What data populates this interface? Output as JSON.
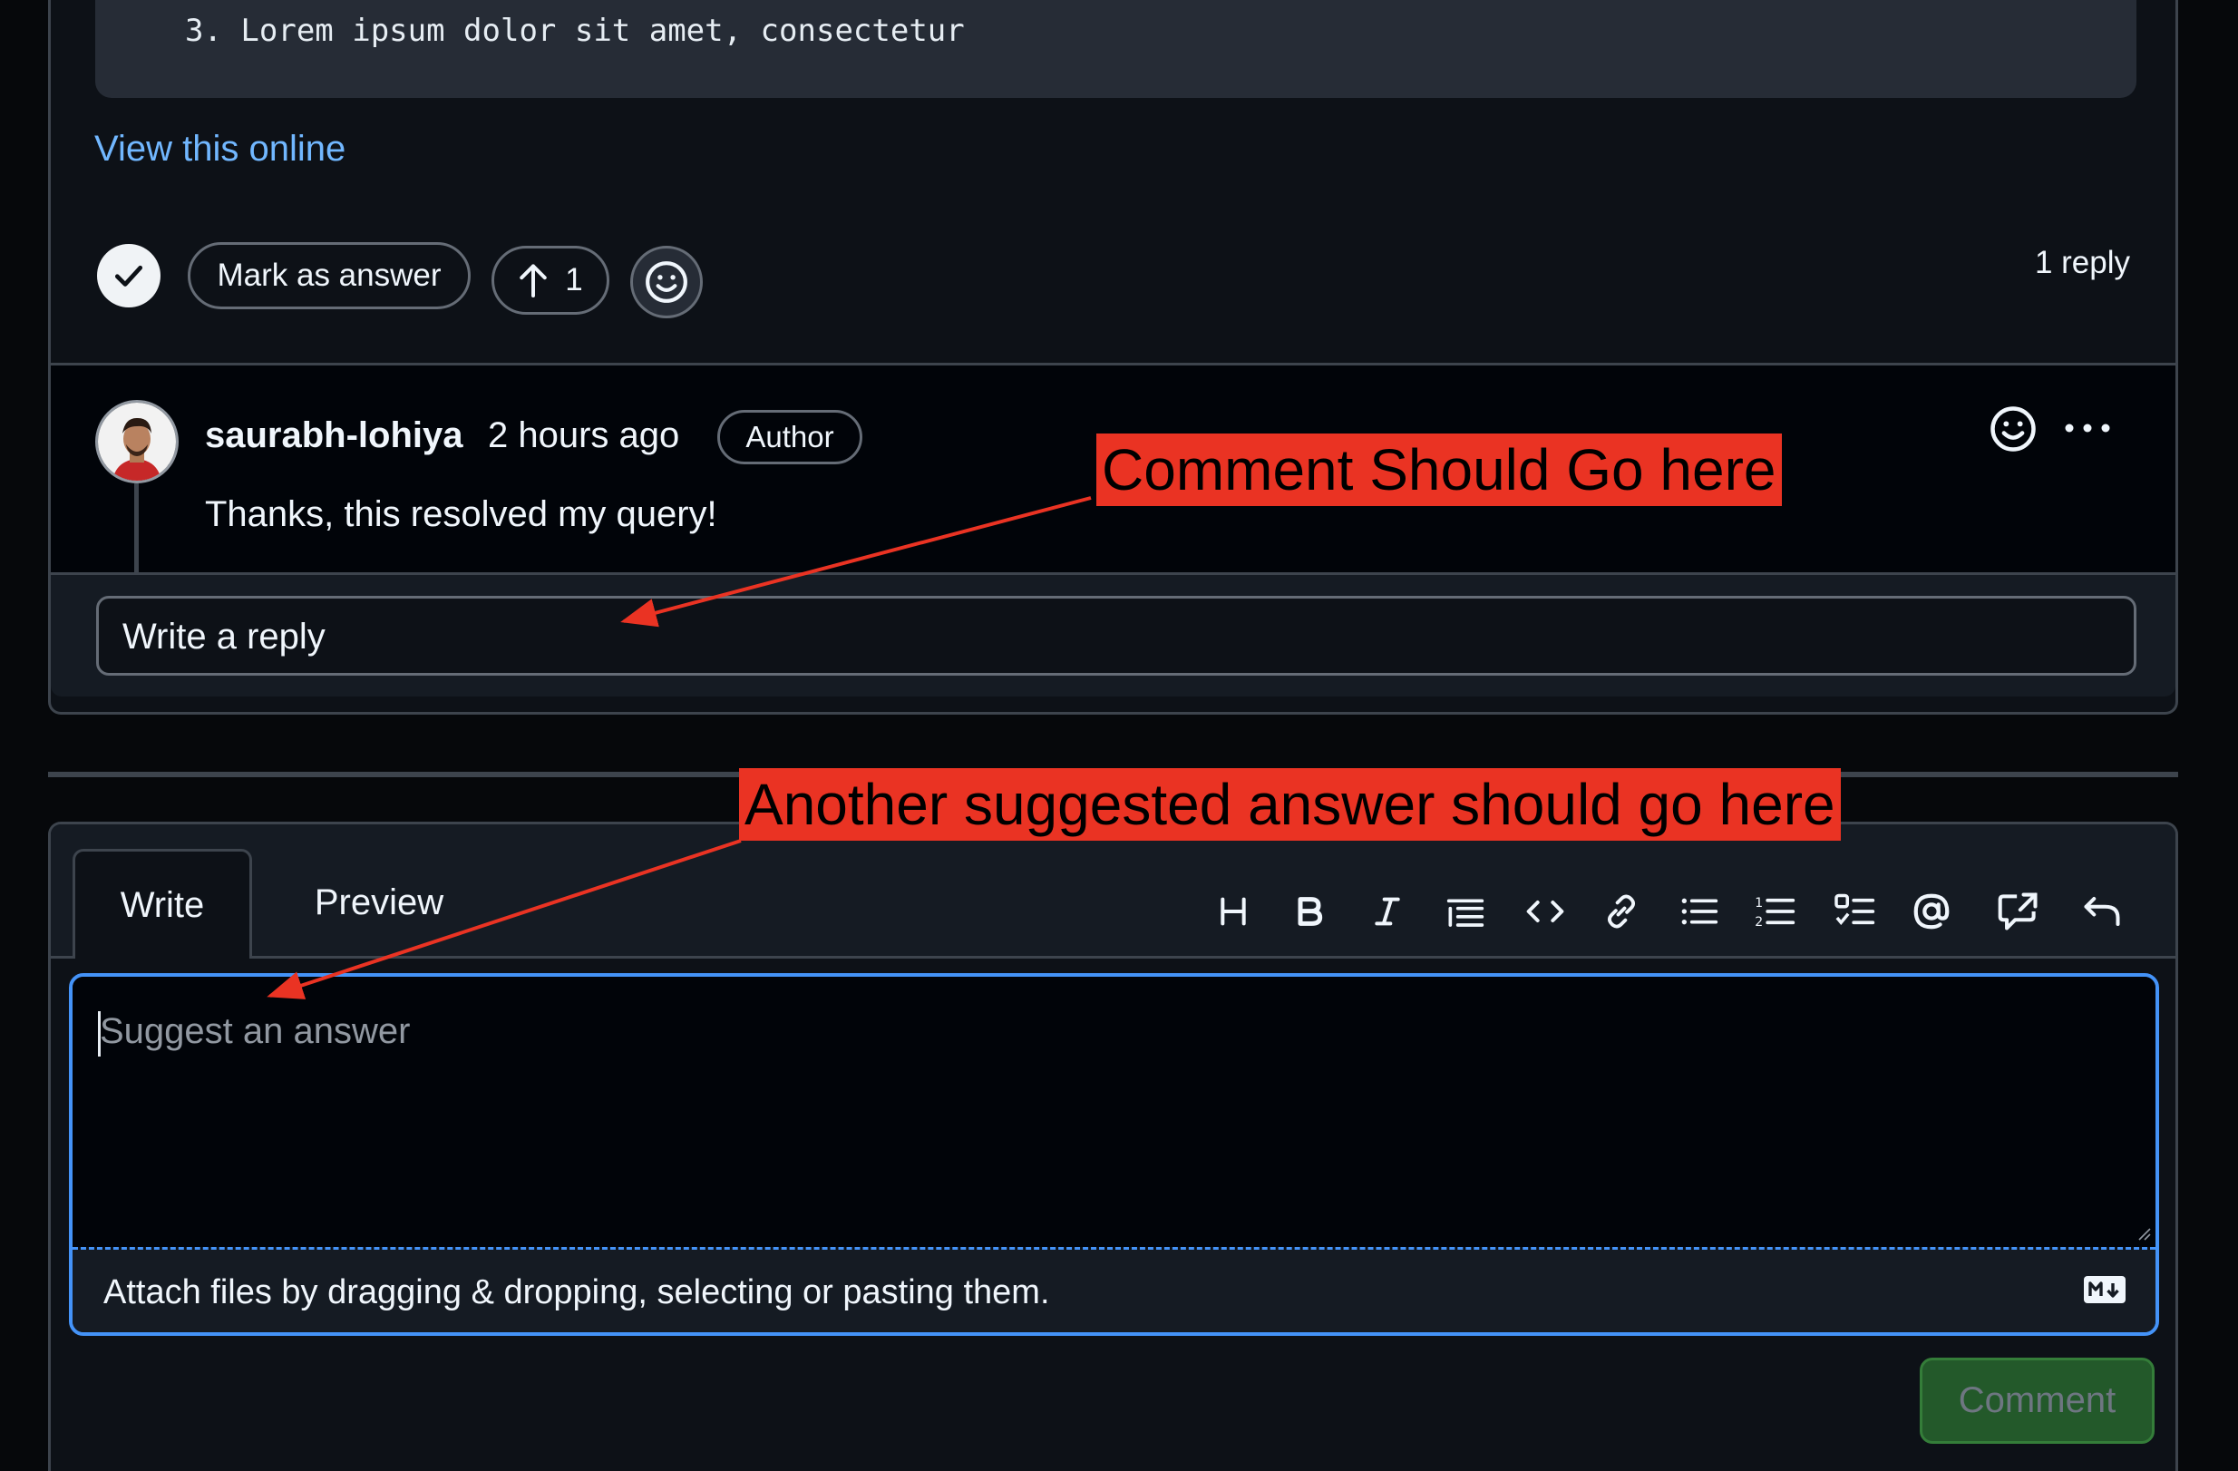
{
  "code": {
    "line3": "3. Lorem ipsum dolor sit amet, consectetur"
  },
  "post": {
    "view_online_label": "View this online",
    "mark_answer_label": "Mark as answer",
    "upvote_count": "1",
    "reply_count": "1 reply"
  },
  "reply": {
    "username": "saurabh-lohiya",
    "time_ago": "2 hours ago",
    "badge": "Author",
    "text": "Thanks, this resolved my query!",
    "write_reply_placeholder": "Write a reply"
  },
  "editor": {
    "tabs": [
      {
        "label": "Write"
      },
      {
        "label": "Preview"
      }
    ],
    "toolbar_icons": [
      "heading-icon",
      "bold-icon",
      "italic-icon",
      "quote-icon",
      "code-icon",
      "link-icon",
      "bulleted-list-icon",
      "numbered-list-icon",
      "task-list-icon",
      "mention-icon",
      "cross-reference-icon",
      "undo-icon"
    ],
    "placeholder": "Suggest an answer",
    "attach_text": "Attach files by dragging & dropping, selecting or pasting them.",
    "submit_label": "Comment"
  },
  "annotations": {
    "first": "Comment Should Go here",
    "second": "Another suggested answer should go here",
    "color": "#ea3323"
  },
  "colors": {
    "background": "#06080b",
    "link": "#71b7ff",
    "focus_border": "#4493f8",
    "comment_button": "#23592a"
  }
}
